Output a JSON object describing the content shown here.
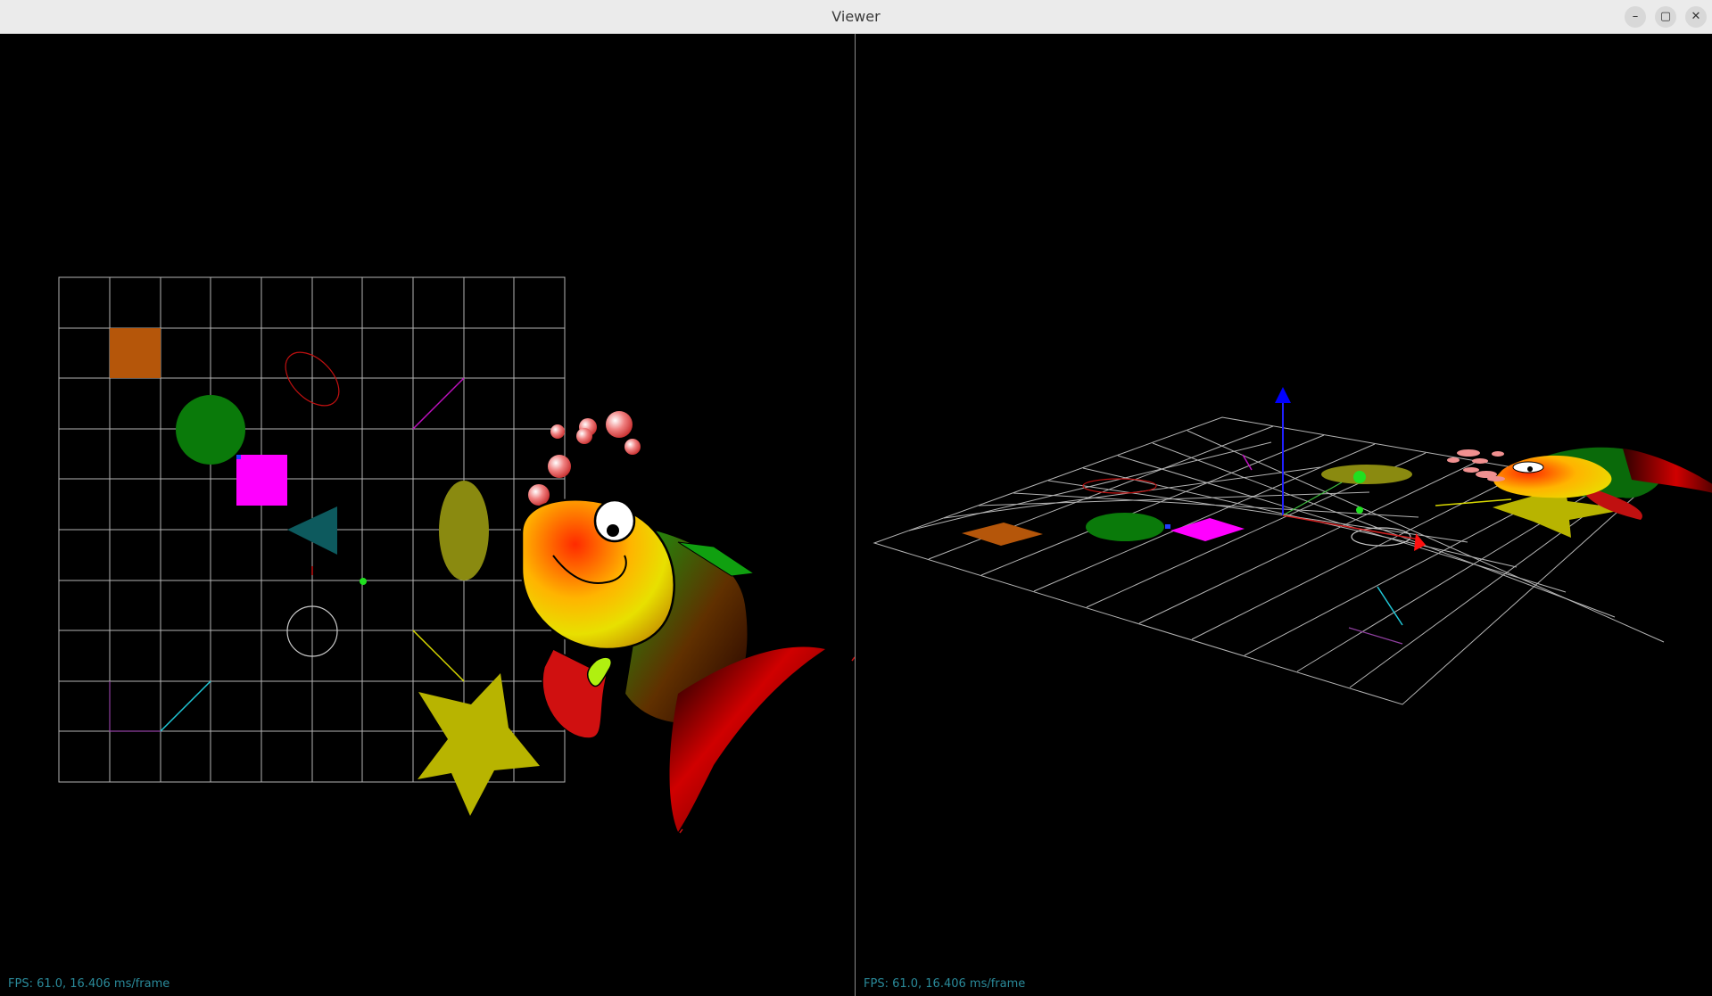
{
  "window": {
    "title": "Viewer",
    "controls": {
      "minimize": "–",
      "maximize": "▢",
      "close": "✕"
    }
  },
  "viewports": {
    "left": {
      "fps_text": "FPS: 61.0, 16.406 ms/frame"
    },
    "right": {
      "fps_text": "FPS: 61.0, 16.406 ms/frame"
    }
  },
  "colors": {
    "grid": "#b4b4b4",
    "orange_square": "#b5560a",
    "green_circle": "#0a7a0a",
    "magenta_square": "#ff00ff",
    "teal_triangle": "#0d5a5e",
    "olive_ellipse": "#8a8a10",
    "star": "#b8b400",
    "fps_text": "#2a8a9a",
    "axis_x": "#ff0000",
    "axis_y": "#00ff00",
    "axis_z": "#0000ff"
  }
}
